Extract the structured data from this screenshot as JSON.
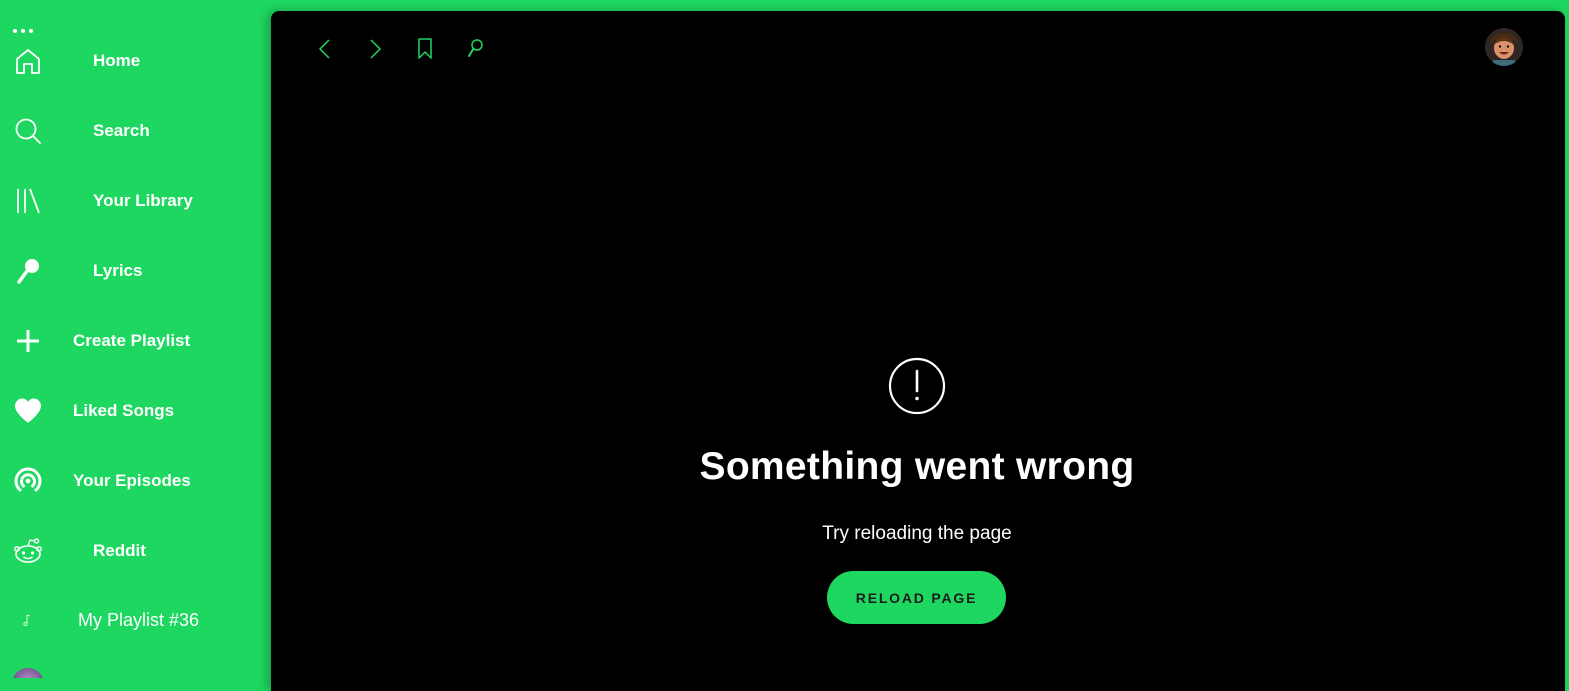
{
  "sidebar": {
    "items": [
      {
        "label": "Home",
        "icon": "home-icon"
      },
      {
        "label": "Search",
        "icon": "search-icon"
      },
      {
        "label": "Your Library",
        "icon": "library-icon"
      },
      {
        "label": "Lyrics",
        "icon": "microphone-icon"
      },
      {
        "label": "Create Playlist",
        "icon": "plus-icon"
      },
      {
        "label": "Liked Songs",
        "icon": "heart-icon"
      },
      {
        "label": "Your Episodes",
        "icon": "podcast-icon"
      },
      {
        "label": "Reddit",
        "icon": "reddit-icon"
      },
      {
        "label": "My Playlist #36",
        "icon": "music-note-icon"
      }
    ]
  },
  "topbar": {
    "icons": [
      "back-arrow-icon",
      "forward-arrow-icon",
      "bookmark-icon",
      "microphone-icon"
    ]
  },
  "error": {
    "icon": "exclamation-circle-icon",
    "title": "Something went wrong",
    "subtitle": "Try reloading the page",
    "button": "RELOAD PAGE"
  },
  "colors": {
    "accent": "#1ed760",
    "background": "#000000",
    "text": "#ffffff"
  }
}
